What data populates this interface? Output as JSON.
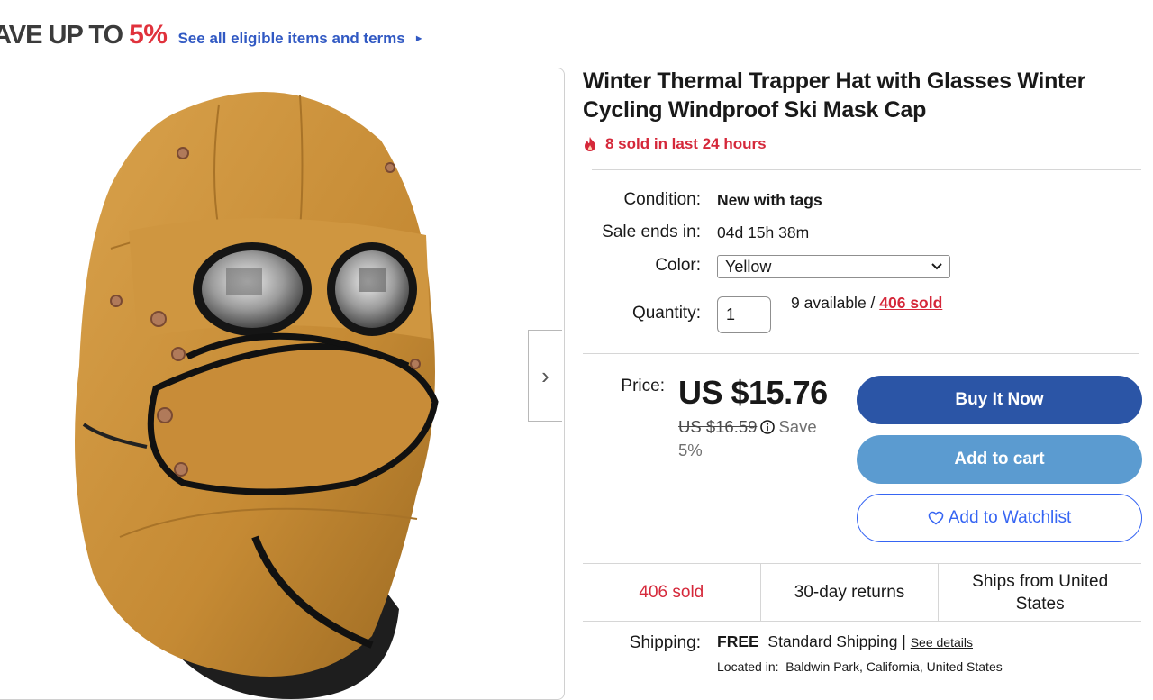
{
  "promo": {
    "lead": "AVE UP TO",
    "percent": "5%",
    "link": "See all eligible items and terms",
    "arrow": "►"
  },
  "gallery": {
    "next_arrow": "›"
  },
  "product": {
    "title": "Winter Thermal Trapper Hat with Glasses Winter Cycling Windproof Ski Mask Cap",
    "hot_text": "8 sold in last 24 hours",
    "hot_icon": "fire-icon"
  },
  "details": {
    "condition_label": "Condition:",
    "condition_value": "New with tags",
    "sale_label": "Sale ends in:",
    "sale_value": "04d 15h 38m",
    "color_label": "Color:",
    "color_value": "Yellow",
    "quantity_label": "Quantity:",
    "quantity_value": "1",
    "available": "9 available / ",
    "sold_link": "406 sold"
  },
  "price": {
    "label": "Price:",
    "current": "US $15.76",
    "original": "US $16.59",
    "save_text": "Save 5%"
  },
  "actions": {
    "buy_now": "Buy It Now",
    "add_to_cart": "Add to cart",
    "watchlist": "Add to Watchlist"
  },
  "stats": {
    "sold": "406 sold",
    "returns": "30-day returns",
    "ships_from": "Ships from United States"
  },
  "shipping": {
    "label": "Shipping:",
    "free": "FREE",
    "method": "Standard Shipping",
    "separator": "|",
    "details_link": "See details",
    "located_label": "Located in:",
    "location": "Baldwin Park, California, United States"
  },
  "colors": {
    "accent_blue": "#3665f3",
    "buy_blue": "#2b55a6",
    "cart_blue": "#5b9bd0",
    "hot_red": "#d5283a"
  }
}
